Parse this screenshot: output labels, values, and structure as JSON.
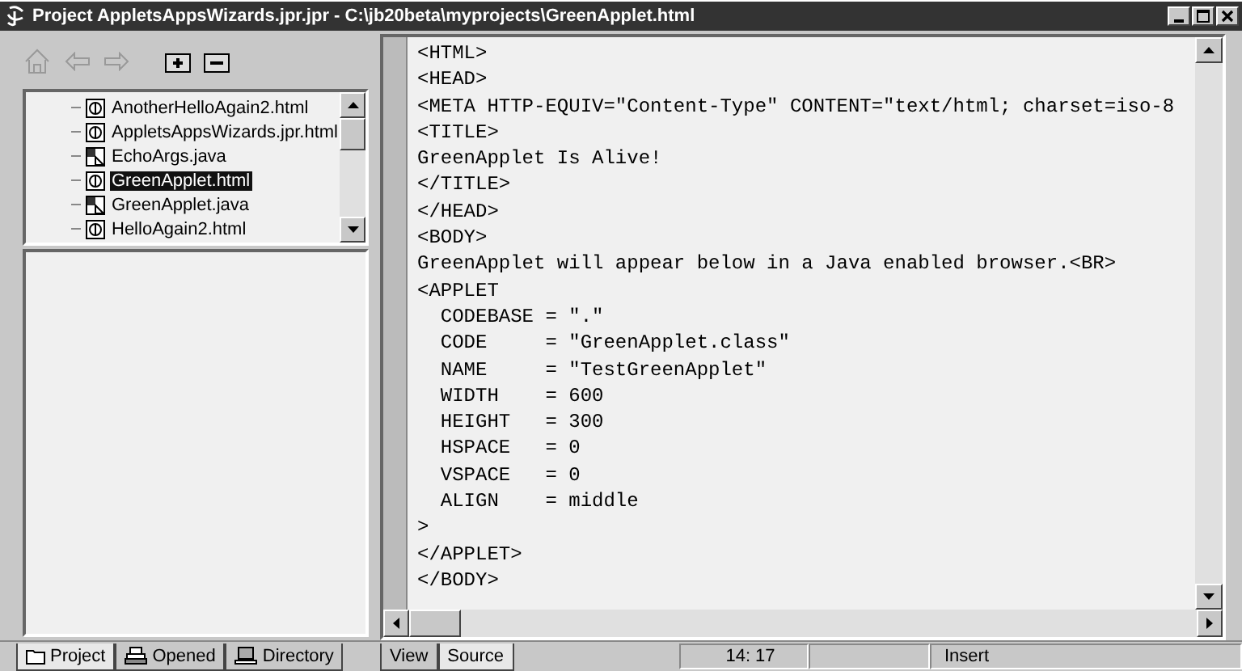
{
  "window": {
    "title": "Project AppletsAppsWizards.jpr.jpr - C:\\jb20beta\\myprojects\\GreenApplet.html"
  },
  "tree": {
    "items": [
      {
        "label": "AnotherHelloAgain2.html",
        "kind": "html",
        "selected": false
      },
      {
        "label": "AppletsAppsWizards.jpr.html",
        "kind": "html",
        "selected": false
      },
      {
        "label": "EchoArgs.java",
        "kind": "java",
        "selected": false
      },
      {
        "label": "GreenApplet.html",
        "kind": "html",
        "selected": true
      },
      {
        "label": "GreenApplet.java",
        "kind": "java",
        "selected": false
      },
      {
        "label": "HelloAgain2.html",
        "kind": "html",
        "selected": false
      }
    ]
  },
  "pane_tabs": [
    {
      "label": "Project",
      "kind": "project",
      "selected": true
    },
    {
      "label": "Opened",
      "kind": "opened",
      "selected": false
    },
    {
      "label": "Directory",
      "kind": "directory",
      "selected": false
    }
  ],
  "editor": {
    "lines": [
      "<HTML>",
      "<HEAD>",
      "<META HTTP-EQUIV=\"Content-Type\" CONTENT=\"text/html; charset=iso-8",
      "<TITLE>",
      "GreenApplet Is Alive!",
      "</TITLE>",
      "</HEAD>",
      "<BODY>",
      "GreenApplet will appear below in a Java enabled browser.<BR>",
      "<APPLET",
      "  CODEBASE = \".\"",
      "  CODE     = \"GreenApplet.class\"",
      "  NAME     = \"TestGreenApplet\"",
      "  WIDTH    = 600",
      "  HEIGHT   = 300",
      "  HSPACE   = 0",
      "  VSPACE   = 0",
      "  ALIGN    = middle",
      ">",
      "</APPLET>",
      "</BODY>"
    ]
  },
  "view_tabs": [
    {
      "label": "View",
      "selected": false
    },
    {
      "label": "Source",
      "selected": true
    }
  ],
  "status_bar": {
    "position": "14: 17",
    "mode": "Insert"
  }
}
